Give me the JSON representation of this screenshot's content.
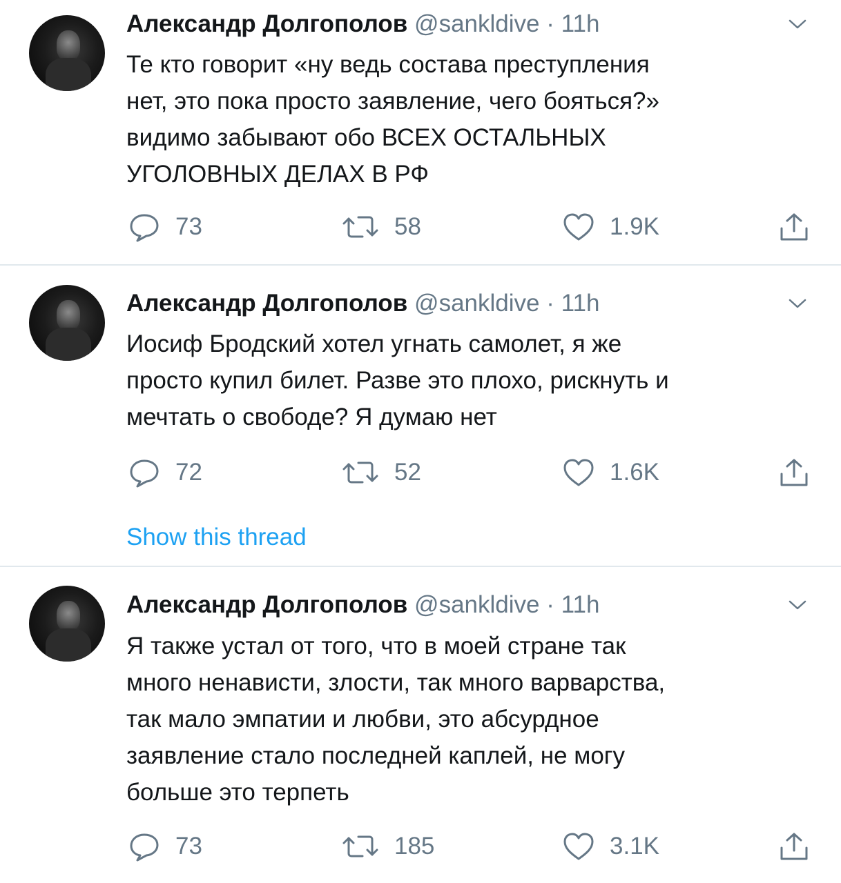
{
  "tweets": [
    {
      "author": "Александр Долгополов",
      "handle": "@sankldive",
      "dot": "·",
      "time": "11h",
      "lines": [
        "Те кто говорит «ну ведь состава преступления",
        "нет, это пока просто заявление, чего бояться?»",
        "видимо забывают обо ВСЕХ ОСТАЛЬНЫХ",
        "УГОЛОВНЫХ ДЕЛАХ В РФ"
      ],
      "replies": "73",
      "retweets": "58",
      "likes": "1.9K"
    },
    {
      "author": "Александр Долгополов",
      "handle": "@sankldive",
      "dot": "·",
      "time": "11h",
      "lines": [
        "Иосиф Бродский хотел угнать самолет, я же",
        "просто купил билет. Разве это плохо, рискнуть и",
        "мечтать о свободе? Я думаю нет"
      ],
      "replies": "72",
      "retweets": "52",
      "likes": "1.6K",
      "show_thread": "Show this thread"
    },
    {
      "author": "Александр Долгополов",
      "handle": "@sankldive",
      "dot": "·",
      "time": "11h",
      "lines": [
        "Я также устал от того, что в моей стране так",
        "много ненависти, злости, так много варварства,",
        "так мало эмпатии и любви, это абсурдное",
        "заявление стало последней каплей, не могу",
        "больше это терпеть"
      ],
      "replies": "73",
      "retweets": "185",
      "likes": "3.1K"
    }
  ],
  "icons": {
    "reply": "reply-icon",
    "retweet": "retweet-icon",
    "like": "heart-icon",
    "share": "share-icon",
    "caret": "chevron-down-icon"
  },
  "colors": {
    "text": "#14171a",
    "secondary": "#657786",
    "link": "#1da1f2",
    "divider": "#e1e8ed"
  }
}
